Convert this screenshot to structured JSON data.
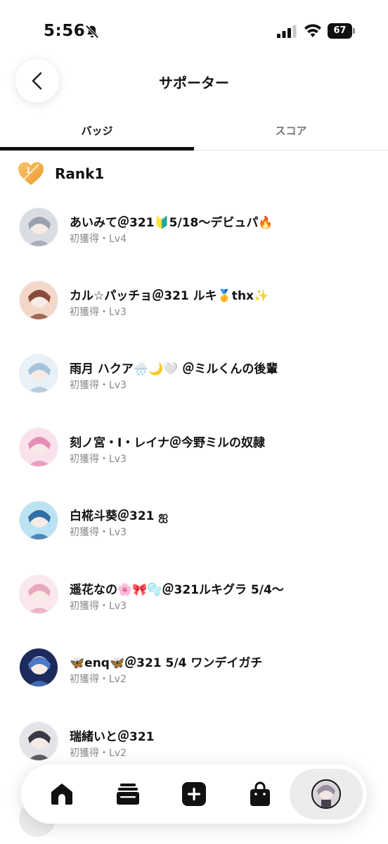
{
  "status_bar": {
    "time": "5:56",
    "battery": "67"
  },
  "header": {
    "title": "サポーター"
  },
  "tabs": [
    {
      "label": "バッジ",
      "active": true
    },
    {
      "label": "スコア",
      "active": false
    }
  ],
  "rank": {
    "label": "Rank1",
    "icon": "heart-rank-1-icon",
    "accent": "#f2a93b"
  },
  "supporters": [
    {
      "name": "あいみて＠321🔰5/18～デビュパ🔥",
      "meta": "初獲得・Lv4",
      "avatar_colors": [
        "#d9dde3",
        "#9aa2ad"
      ]
    },
    {
      "name": "カル☆パッチョ＠321 ルキ🥇thx✨",
      "meta": "初獲得・Lv3",
      "avatar_colors": [
        "#f3d7c8",
        "#8a4b3a"
      ]
    },
    {
      "name": "雨月 ハクア🌧️🌙🤍 ＠ミルくんの後輩",
      "meta": "初獲得・Lv3",
      "avatar_colors": [
        "#e8f1f8",
        "#a6c4dc"
      ]
    },
    {
      "name": "刻ノ宮・I・レイナ＠今野ミルの奴隷",
      "meta": "初獲得・Lv3",
      "avatar_colors": [
        "#fbe1ec",
        "#e58fb6"
      ]
    },
    {
      "name": "白椛斗葵＠321 ஐ",
      "meta": "初獲得・Lv3",
      "avatar_colors": [
        "#b9e3f3",
        "#2f6fa8"
      ]
    },
    {
      "name": "遥花なの🌸🎀🫧＠321ルキグラ 5/4～",
      "meta": "初獲得・Lv3",
      "avatar_colors": [
        "#fbe8ee",
        "#e9a8bf"
      ]
    },
    {
      "name": "🦋enq🦋＠321 5/4 ワンデイガチ",
      "meta": "初獲得・Lv2",
      "avatar_colors": [
        "#1c2a5c",
        "#4b78c8"
      ]
    },
    {
      "name": "瑞緒いと＠321",
      "meta": "初獲得・Lv2",
      "avatar_colors": [
        "#e4e4e8",
        "#3a3a44"
      ]
    }
  ],
  "bottom_nav": [
    {
      "name": "home",
      "icon": "home-icon",
      "active": false
    },
    {
      "name": "cards",
      "icon": "cards-stack-icon",
      "active": false
    },
    {
      "name": "create",
      "icon": "plus-square-icon",
      "active": false
    },
    {
      "name": "shop",
      "icon": "shopping-bag-icon",
      "active": false
    },
    {
      "name": "profile",
      "icon": "profile-avatar",
      "active": true
    }
  ]
}
